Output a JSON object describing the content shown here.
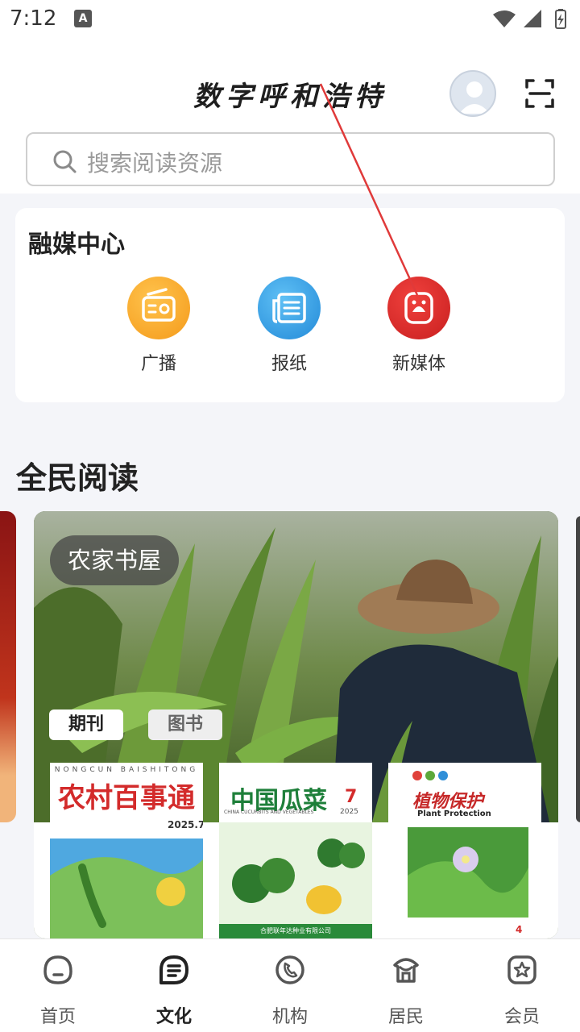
{
  "status_bar": {
    "time": "7:12",
    "notification_letter": "A"
  },
  "header": {
    "app_title": "数字呼和浩特",
    "search_placeholder": "搜索阅读资源"
  },
  "media_center": {
    "title": "融媒中心",
    "items": [
      {
        "label": "广播",
        "icon": "radio-icon",
        "color": "#f7a625"
      },
      {
        "label": "报纸",
        "icon": "newspaper-icon",
        "color": "#2f9fe4"
      },
      {
        "label": "新媒体",
        "icon": "new-media-icon",
        "color": "#e02c2c"
      }
    ]
  },
  "reading": {
    "title": "全民阅读",
    "banner": {
      "badge": "农家书屋",
      "tabs": [
        "期刊",
        "图书"
      ],
      "covers": [
        {
          "title": "农村百事通",
          "subtitle": "NONGCUN BAISHITONG",
          "issue": "2025.7"
        },
        {
          "title": "中国瓜菜",
          "subtitle": "CHINA CUCURBITS AND VEGETABLES",
          "issue": "7",
          "year": "2025",
          "footer": "合肥联年达种业有限公司"
        },
        {
          "title": "植物保护",
          "subtitle": "Plant Protection",
          "issue": "4"
        }
      ]
    }
  },
  "bottom_nav": {
    "items": [
      {
        "label": "首页",
        "icon": "home-icon"
      },
      {
        "label": "文化",
        "icon": "culture-icon",
        "active": true
      },
      {
        "label": "机构",
        "icon": "institution-icon"
      },
      {
        "label": "居民",
        "icon": "resident-icon"
      },
      {
        "label": "会员",
        "icon": "member-icon"
      }
    ]
  },
  "colors": {
    "accent_red": "#e02c2c",
    "orange": "#f7a625",
    "blue": "#2f9fe4",
    "nav_icon": "#555555"
  }
}
